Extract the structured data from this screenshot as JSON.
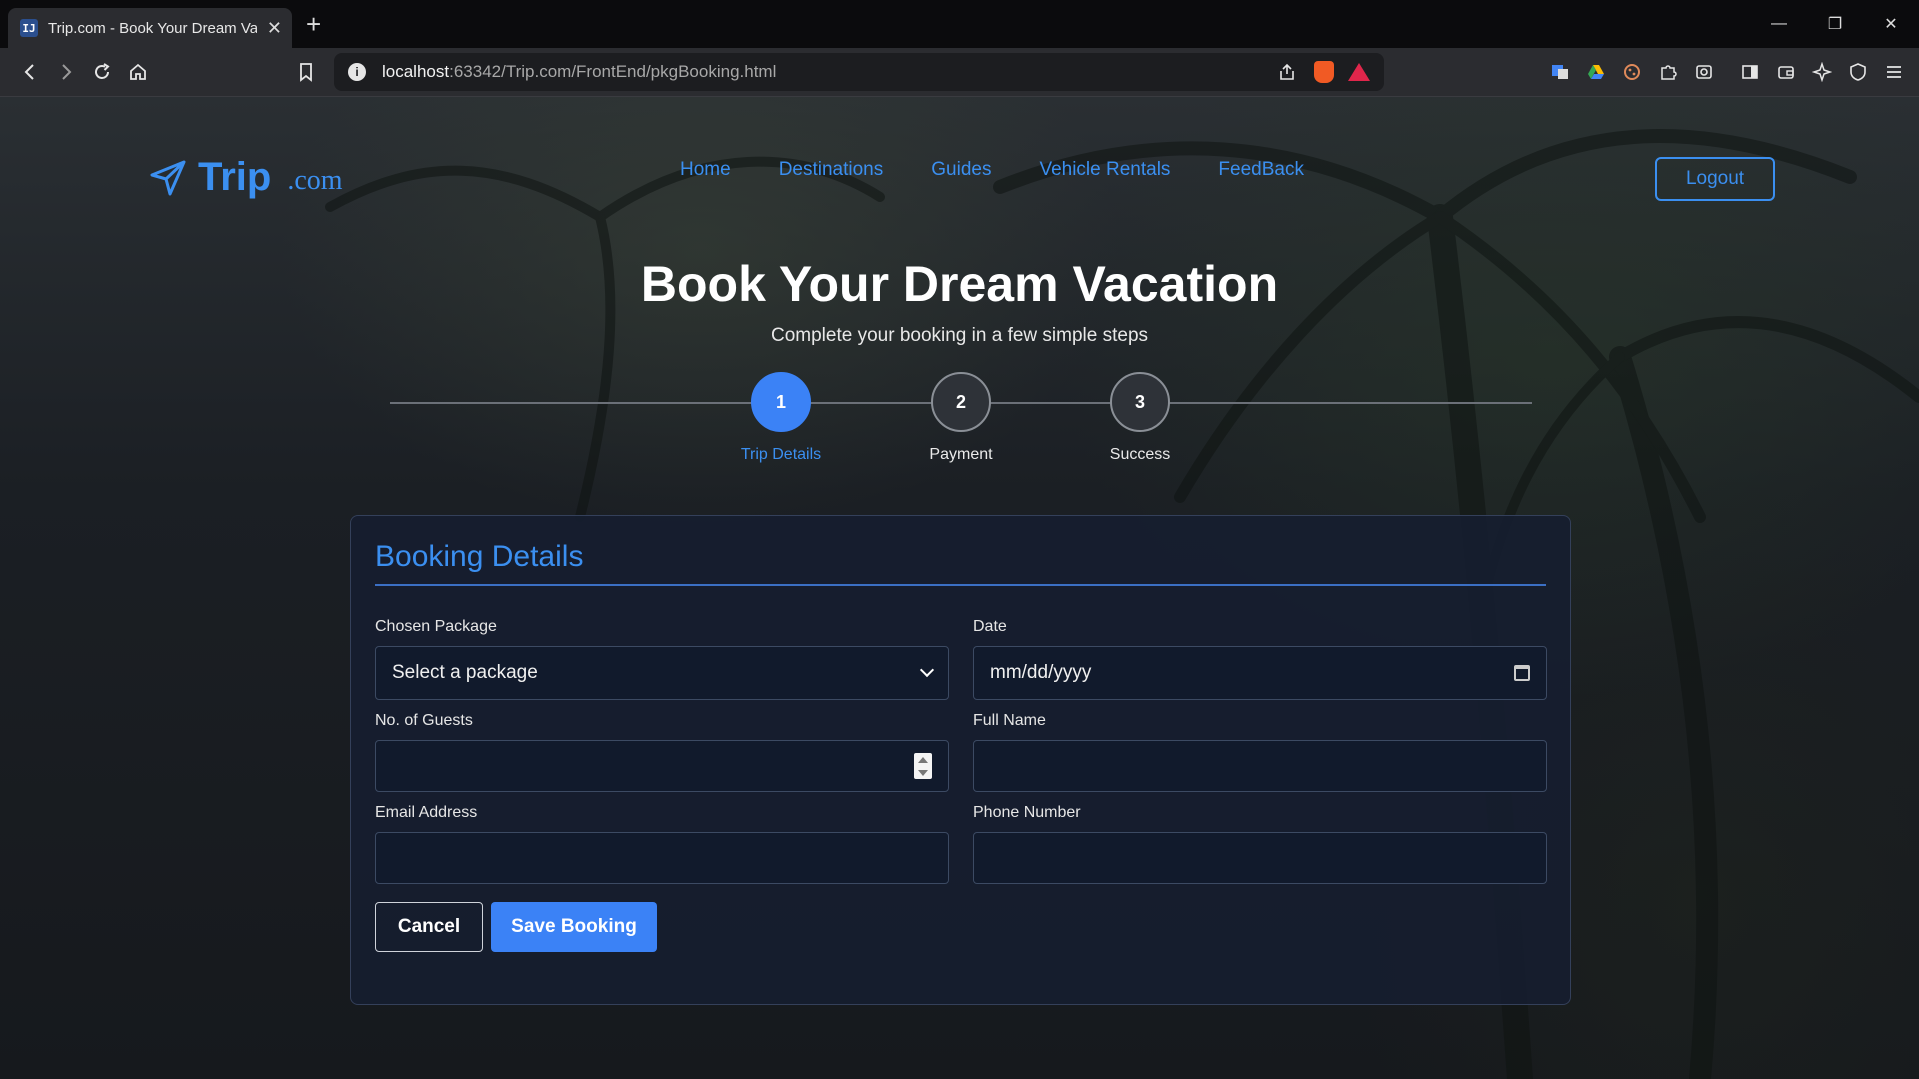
{
  "browser": {
    "tab_title": "Trip.com - Book Your Dream Vac",
    "url_host": "localhost",
    "url_rest": ":63342/Trip.com/FrontEnd/pkgBooking.html"
  },
  "nav": {
    "brand_main": "Trip",
    "brand_suffix": ".com",
    "links": [
      "Home",
      "Destinations",
      "Guides",
      "Vehicle Rentals",
      "FeedBack"
    ],
    "logout": "Logout"
  },
  "hero": {
    "title": "Book Your Dream Vacation",
    "subtitle": "Complete your booking in a few simple steps"
  },
  "steps": [
    {
      "number": "1",
      "label": "Trip Details",
      "active": true
    },
    {
      "number": "2",
      "label": "Payment",
      "active": false
    },
    {
      "number": "3",
      "label": "Success",
      "active": false
    }
  ],
  "form": {
    "title": "Booking Details",
    "package_label": "Chosen Package",
    "package_value": "Select a package",
    "date_label": "Date",
    "date_value": "mm/dd/yyyy",
    "guests_label": "No. of Guests",
    "guests_value": "",
    "name_label": "Full Name",
    "name_value": "",
    "email_label": "Email Address",
    "email_value": "",
    "phone_label": "Phone Number",
    "phone_value": "",
    "cancel": "Cancel",
    "save": "Save Booking"
  },
  "colors": {
    "accent": "#3b82f6",
    "link": "#3b8ff0"
  }
}
